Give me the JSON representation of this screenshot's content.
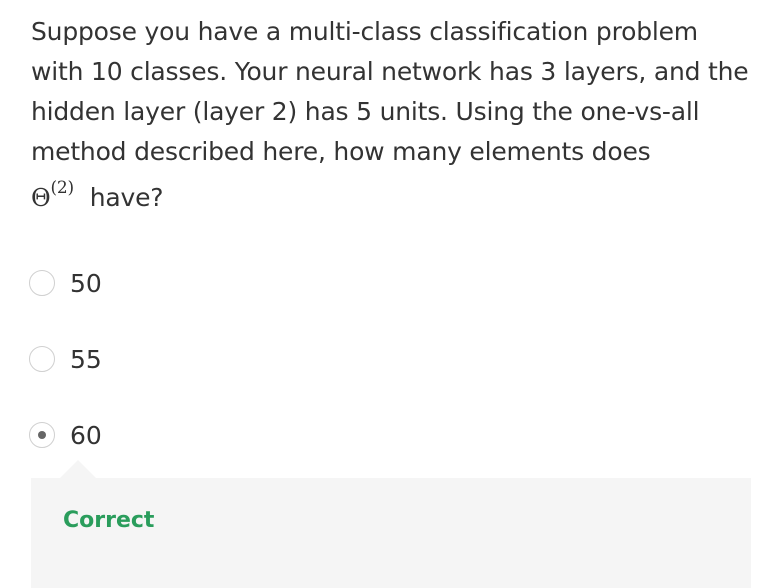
{
  "question": {
    "text": "Suppose you have a multi-class classification problem with 10 classes. Your neural network has 3 layers, and the hidden layer (layer 2) has 5 units. Using the one-vs-all method described here, how many elements does",
    "symbol": "Θ",
    "superscript": "(2)",
    "text_end": "have?"
  },
  "options": [
    {
      "label": "50",
      "selected": false
    },
    {
      "label": "55",
      "selected": false
    },
    {
      "label": "60",
      "selected": true
    }
  ],
  "feedback": {
    "label": "Correct",
    "color": "#2a9d5c"
  }
}
